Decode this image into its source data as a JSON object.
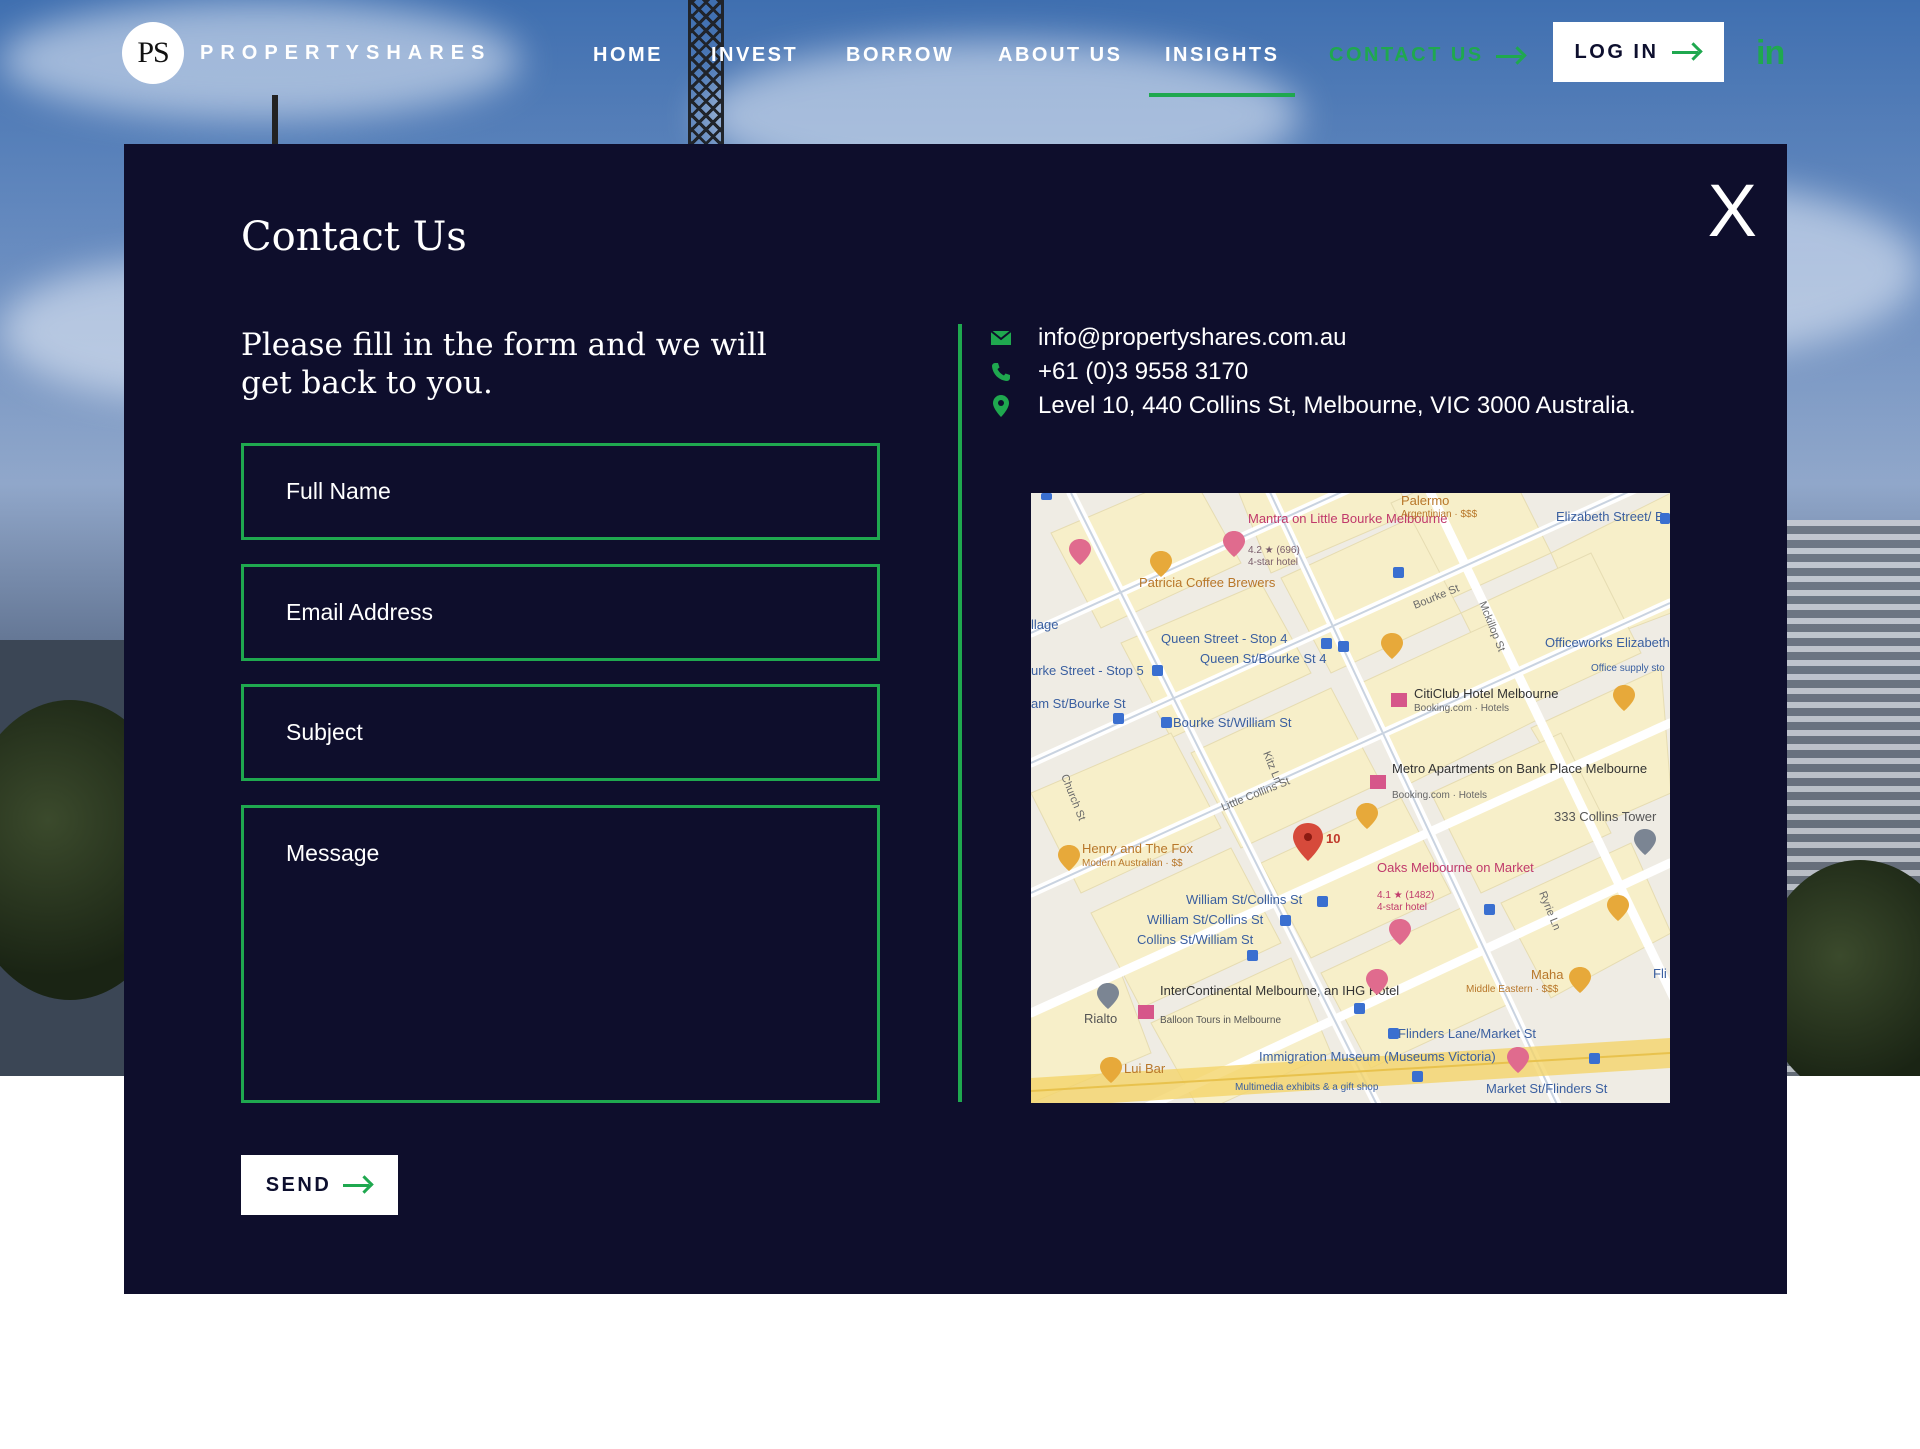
{
  "header": {
    "logo_mark": "PS",
    "logo_text": "PROPERTYSHARES",
    "nav": {
      "home": "HOME",
      "invest": "INVEST",
      "borrow": "BORROW",
      "about": "ABOUT US",
      "insights": "INSIGHTS",
      "contact": "CONTACT US"
    },
    "login_label": "LOG IN",
    "linkedin_label": "in"
  },
  "modal": {
    "close_label": "X",
    "title": "Contact Us",
    "intro": "Please fill in the form and we will get back to you.",
    "form": {
      "full_name_placeholder": "Full Name",
      "email_placeholder": "Email Address",
      "subject_placeholder": "Subject",
      "message_placeholder": "Message",
      "send_label": "SEND"
    },
    "contact": {
      "email": "info@propertyshares.com.au",
      "phone": "+61 (0)3 9558 3170",
      "address": "Level 10, 440 Collins St, Melbourne, VIC 3000 Australia."
    },
    "map": {
      "labels": {
        "mantra": "Mantra on Little Bourke Melbourne",
        "mantra_rating": "4.2 ★ (696)",
        "mantra_type": "4-star hotel",
        "palermo": "Palermo",
        "palermo_sub": "Argentinian · $$$",
        "elizabeth": "Elizabeth Street/ Bourke Street",
        "patricia": "Patricia Coffee Brewers",
        "bourke_st": "Bourke St",
        "mckillop": "Mckillop St",
        "officeworks": "Officeworks Elizabeth St, Melbourne",
        "officeworks_sub": "Office supply sto",
        "village": "llage",
        "queen_stop": "Queen Street - Stop 4",
        "queen_bourke": "Queen St/Bourke St 4",
        "bourke_stop5": "urke Street - Stop 5",
        "citiclub": "CitiClub Hotel Melbourne",
        "citiclub_sub": "Booking.com · Hotels",
        "william_bourke_left": "am St/Bourke St",
        "bourke_william": "Bourke St/William St",
        "kitz": "Kitz Ln",
        "metro": "Metro Apartments on Bank Place Melbourne",
        "metro_sub": "Booking.com · Hotels",
        "little_collins": "Little Collins St",
        "church": "Church St",
        "collins333": "333 Collins Tower",
        "pin_label": "10",
        "henry": "Henry and The Fox",
        "henry_sub": "Modern Australian · $$",
        "oaks": "Oaks Melbourne on Market",
        "oaks_rating": "4.1 ★ (1482)",
        "oaks_type": "4-star hotel",
        "william_collins1": "William St/Collins St",
        "william_collins2": "William St/Collins St",
        "collins_william": "Collins St/William St",
        "ryrie": "Ryrie Ln",
        "rialto": "Rialto",
        "intercontinental": "InterContinental Melbourne, an IHG Hotel",
        "balloon": "Balloon Tours in Melbourne",
        "maha": "Maha",
        "maha_sub": "Middle Eastern · $$$",
        "fli": "Fli",
        "flinders_lane": "Flinders Lane/Market St",
        "lui": "Lui Bar",
        "immigration": "Immigration Museum (Museums Victoria)",
        "immigration_sub": "Multimedia exhibits & a gift shop",
        "market_flinders": "Market St/Flinders St"
      }
    }
  },
  "colors": {
    "accent": "#1fa84f",
    "modal_bg": "#0e0e2c",
    "white": "#ffffff"
  },
  "icons": [
    "email-icon",
    "phone-icon",
    "location-pin-icon",
    "arrow-right-icon",
    "linkedin-icon",
    "close-icon"
  ]
}
